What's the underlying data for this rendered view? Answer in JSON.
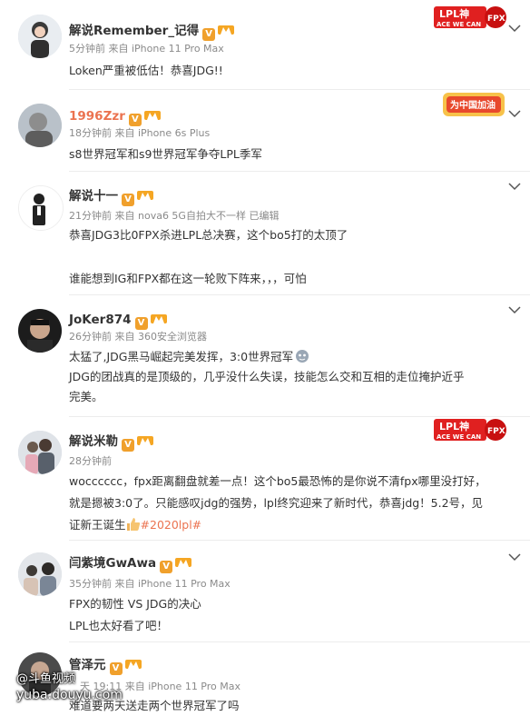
{
  "comments": [
    {
      "name": "解说Remember_记得",
      "meta": "5分钟前 来自 iPhone 11 Pro Max",
      "lines": [
        "Loken严重被低估！恭喜JDG!!"
      ]
    },
    {
      "name": "1996Zzr",
      "meta": "18分钟前 来自 iPhone 6s Plus",
      "lines": [
        "s8世界冠军和s9世界冠军争夺LPL季军"
      ]
    },
    {
      "name": "解说十一",
      "meta": "21分钟前 来自 nova6 5G自拍大不一样  已编辑",
      "lines": [
        "恭喜JDG3比0FPX杀进LPL总决赛，这个bo5打的太顶了",
        "",
        "谁能想到IG和FPX都在这一轮败下阵来，，，可怕"
      ]
    },
    {
      "name": "JoKer874",
      "meta": "26分钟前 来自 360安全浏览器",
      "lines": [
        "太猛了,JDG黑马崛起完美发挥，3:0世界冠军",
        "JDG的团战真的是顶级的，几乎没什么失误，技能怎么交和互相的走位掩护近乎",
        "完美。"
      ]
    },
    {
      "name": "解说米勒",
      "meta": "28分钟前",
      "lines": [
        "wocccccc，fpx距离翻盘就差一点！这个bo5最恐怖的是你说不清fpx哪里没打好，",
        "就是摁被3:0了。只能感叹jdg的强势，lpl终究迎来了新时代，恭喜jdg！5.2号，见",
        "证新王诞生"
      ],
      "tag": "#2020lpl#"
    },
    {
      "name": "闫紫境GwAwa",
      "meta": "35分钟前 来自 iPhone 11 Pro Max",
      "lines": [
        "FPX的韧性 VS JDG的决心",
        "LPL也太好看了吧！"
      ]
    },
    {
      "name": "管泽元",
      "meta": "天 19:11 来自 iPhone 11 Pro Max",
      "lines": [
        "难道要两天送走两个世界冠军了吗"
      ]
    }
  ],
  "badges": {
    "v": "V"
  },
  "stickers": {
    "top": "LPL神 ACE WE CAN FPX",
    "middle": "为中国加油"
  },
  "watermark": {
    "line1": "@斗鱼视频",
    "line2": "yuba.douyu.com"
  },
  "colors": {
    "name_red": "#eb7350",
    "meta": "#8a8a8a",
    "badge": "#f0a02c"
  },
  "icons": [
    "chevron-down-icon",
    "verified-v-icon",
    "level-badge-icon",
    "avatar"
  ]
}
